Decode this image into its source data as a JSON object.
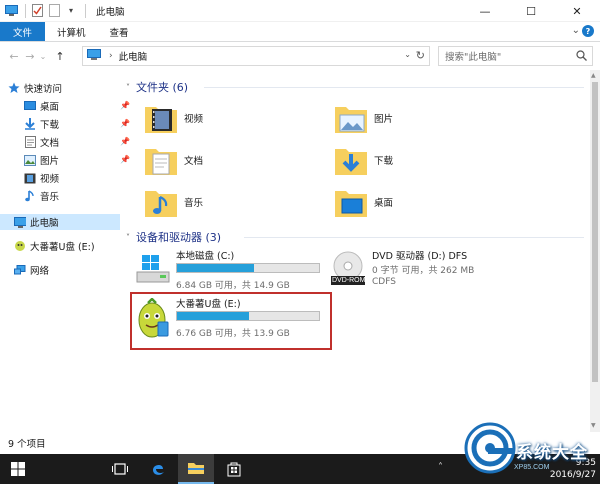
{
  "window": {
    "title": "此电脑",
    "min": "—",
    "max": "☐",
    "close": "✕"
  },
  "ribbon": {
    "tabs": [
      "文件",
      "计算机",
      "查看"
    ],
    "expand": "⌄",
    "help": "?"
  },
  "addressbar": {
    "back": "←",
    "forward": "→",
    "recent": "⌄",
    "up": "↑",
    "path": "此电脑",
    "sep": "›",
    "search_placeholder": "搜索\"此电脑\""
  },
  "nav": {
    "quick_access": "快速访问",
    "items": [
      "桌面",
      "下载",
      "文档",
      "图片",
      "视频",
      "音乐"
    ],
    "this_pc": "此电脑",
    "usb": "大番薯U盘 (E:)",
    "network": "网络"
  },
  "folders_group": "文件夹 (6)",
  "folders": [
    "视频",
    "图片",
    "文档",
    "下载",
    "音乐",
    "桌面"
  ],
  "devices_group": "设备和驱动器 (3)",
  "drives": [
    {
      "name": "本地磁盘 (C:)",
      "info": "6.84 GB 可用，共 14.9 GB",
      "used_fraction": 0.54
    },
    {
      "name": "DVD 驱动器 (D:) DFS",
      "info": "0 字节 可用，共 262 MB",
      "fs": "CDFS",
      "label": "DVD-ROM"
    },
    {
      "name": "大番薯U盘 (E:)",
      "info": "6.76 GB 可用，共 13.9 GB",
      "used_fraction": 0.51
    }
  ],
  "status": "9 个项目",
  "taskbar": {
    "time": "9:35",
    "date": "2016/9/27"
  },
  "watermark": {
    "text": "系统大全",
    "url": "XP85.COM"
  },
  "colors": {
    "accent": "#1979ca",
    "bar_fill": "#26a0da",
    "highlight": "#c0302c",
    "folder": "#f6cf5e"
  }
}
